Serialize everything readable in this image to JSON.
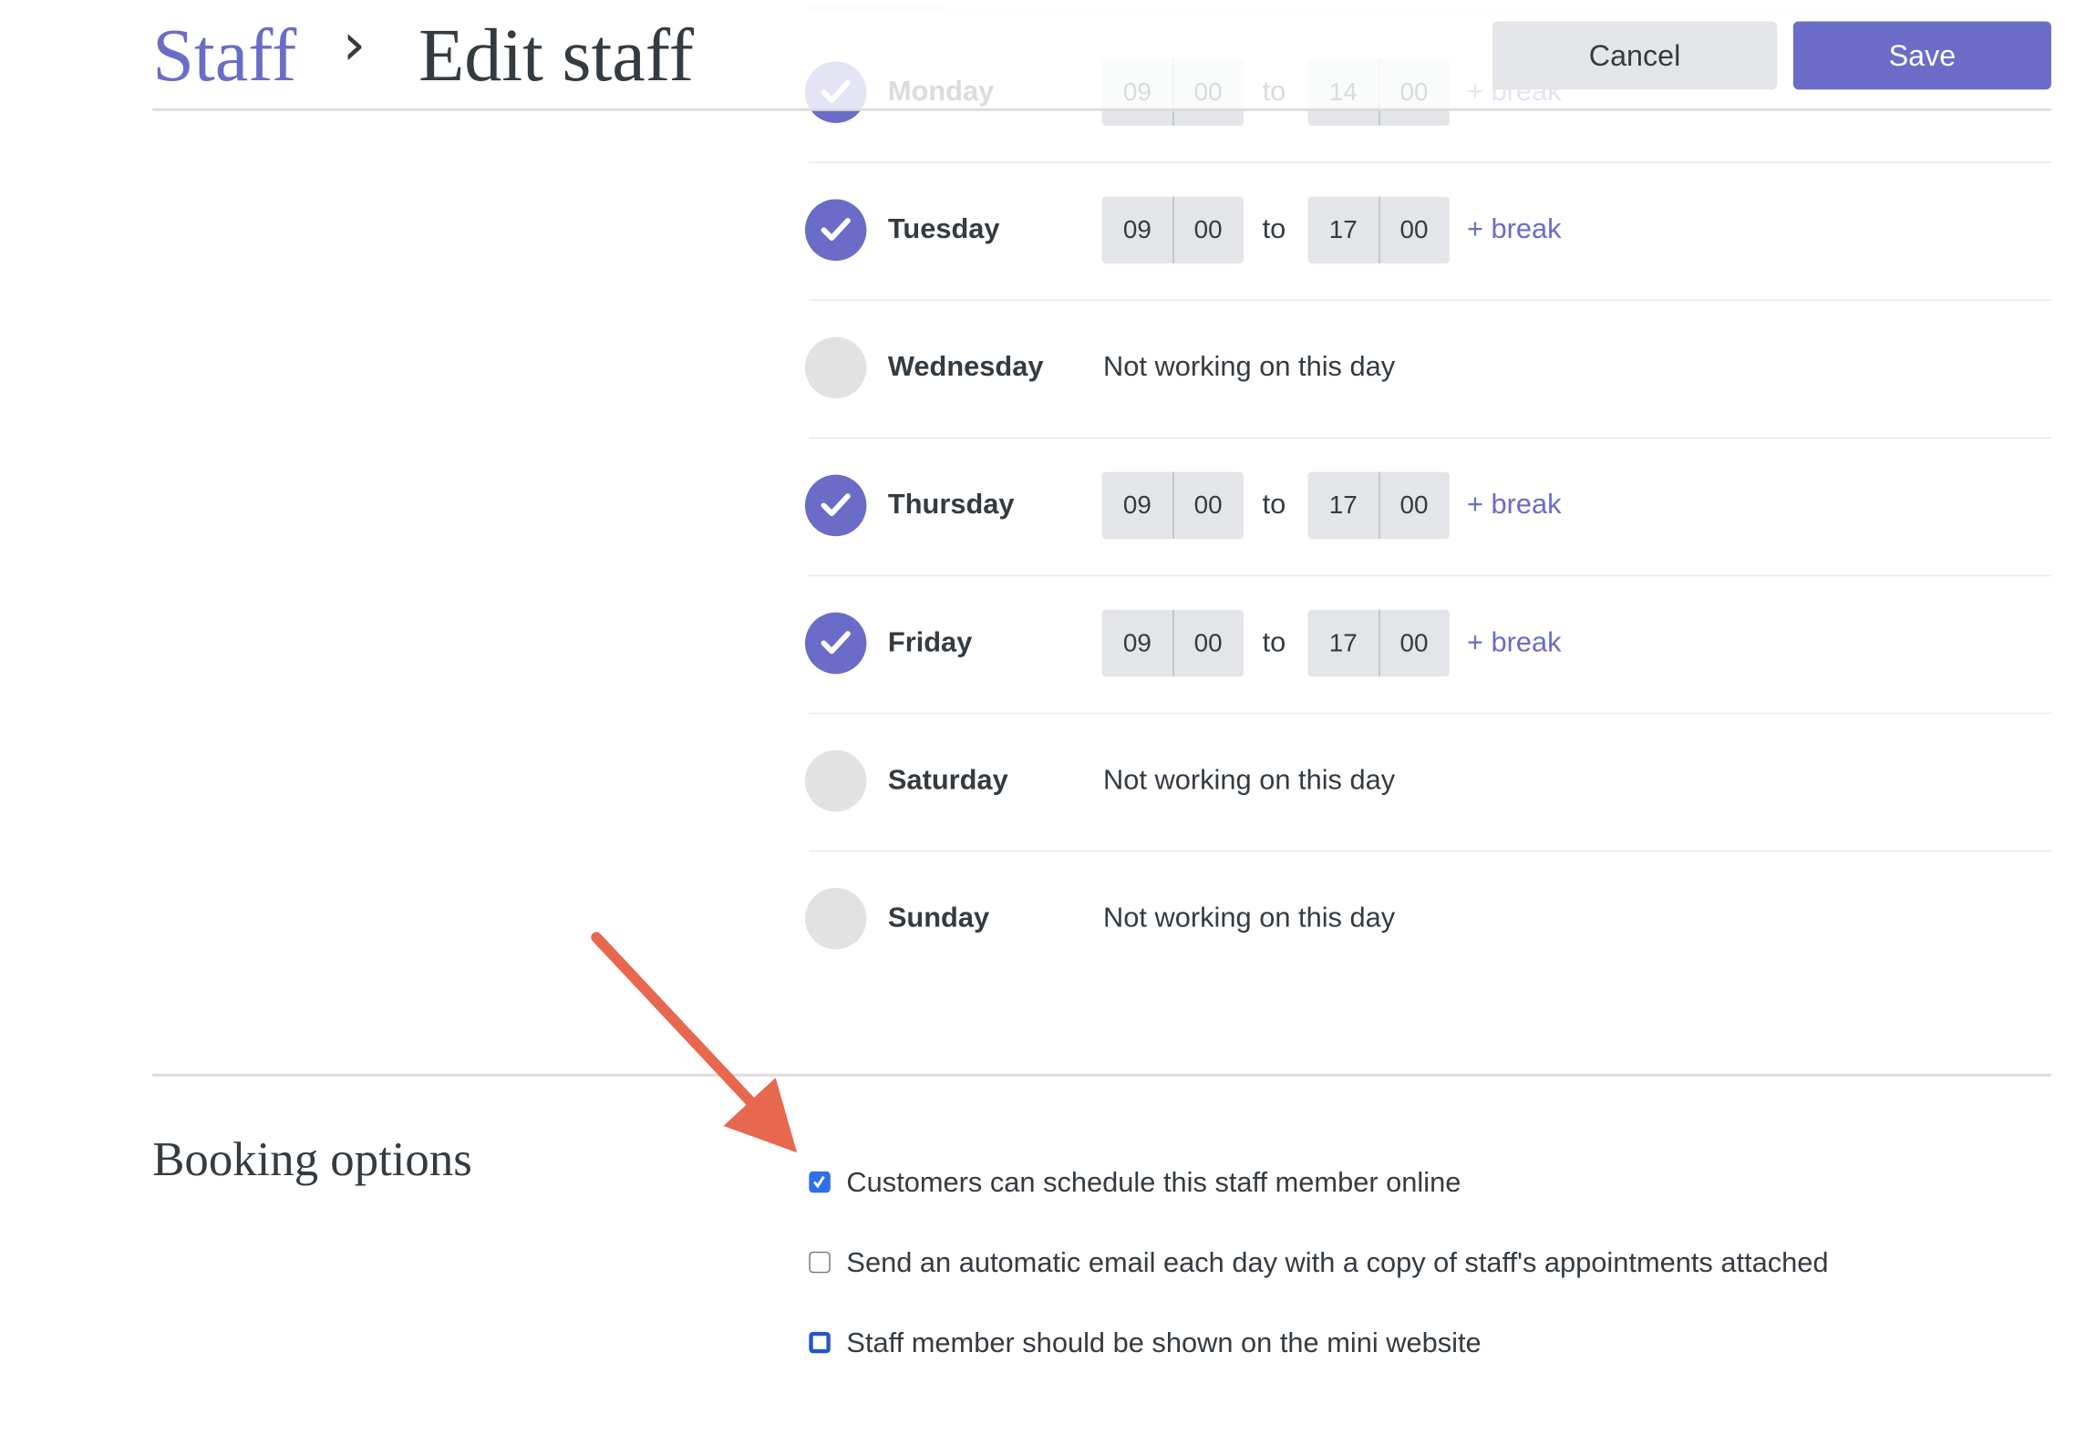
{
  "header": {
    "breadcrumb_parent": "Staff",
    "separator": "›",
    "title": "Edit staff",
    "cancel_label": "Cancel",
    "save_label": "Save"
  },
  "colors": {
    "accent": "#6b6cc8",
    "arrow": "#e8674f",
    "checkbox": "#2f6fe8"
  },
  "schedule": {
    "to_label": "to",
    "break_label": "+ break",
    "not_working_label": "Not working on this day",
    "days": [
      {
        "name": "Monday",
        "working": true,
        "start_h": "09",
        "start_m": "00",
        "end_h": "14",
        "end_m": "00"
      },
      {
        "name": "Tuesday",
        "working": true,
        "start_h": "09",
        "start_m": "00",
        "end_h": "17",
        "end_m": "00"
      },
      {
        "name": "Wednesday",
        "working": false
      },
      {
        "name": "Thursday",
        "working": true,
        "start_h": "09",
        "start_m": "00",
        "end_h": "17",
        "end_m": "00"
      },
      {
        "name": "Friday",
        "working": true,
        "start_h": "09",
        "start_m": "00",
        "end_h": "17",
        "end_m": "00"
      },
      {
        "name": "Saturday",
        "working": false
      },
      {
        "name": "Sunday",
        "working": false
      }
    ]
  },
  "booking": {
    "title": "Booking options",
    "options": [
      {
        "label": "Customers can schedule this staff member online",
        "checked": true
      },
      {
        "label": "Send an automatic email each day with a copy of staff's appointments attached",
        "checked": false
      },
      {
        "label": "Staff member should be shown on the mini website",
        "checked": false
      }
    ]
  }
}
